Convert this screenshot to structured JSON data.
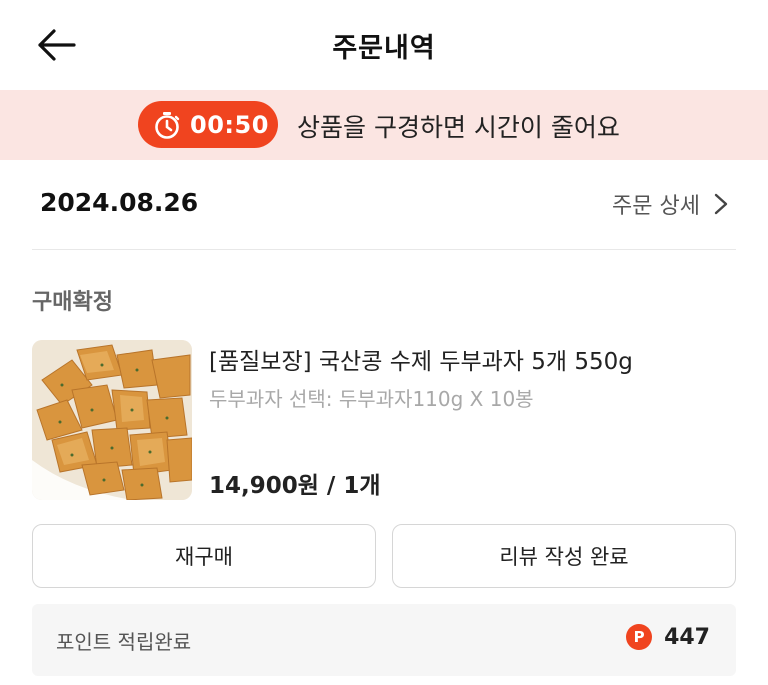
{
  "header": {
    "title": "주문내역",
    "back_icon": "arrow-left-icon"
  },
  "timer_banner": {
    "time": "00:50",
    "message": "상품을 구경하면 시간이 줄어요",
    "icon": "stopwatch-icon",
    "accent_color": "#f0441f",
    "background_color": "#fbe5e2"
  },
  "order": {
    "date": "2024.08.26",
    "detail_link": "주문 상세",
    "status": "구매확정"
  },
  "product": {
    "name": "[품질보장] 국산콩 수제 두부과자 5개 550g",
    "option": "두부과자 선택: 두부과자110g X 10봉",
    "price": "14,900원 / 1개"
  },
  "actions": {
    "rebuy_label": "재구매",
    "review_label": "리뷰 작성 완료"
  },
  "points": {
    "label": "포인트 적립완료",
    "badge": "P",
    "value": "447"
  }
}
